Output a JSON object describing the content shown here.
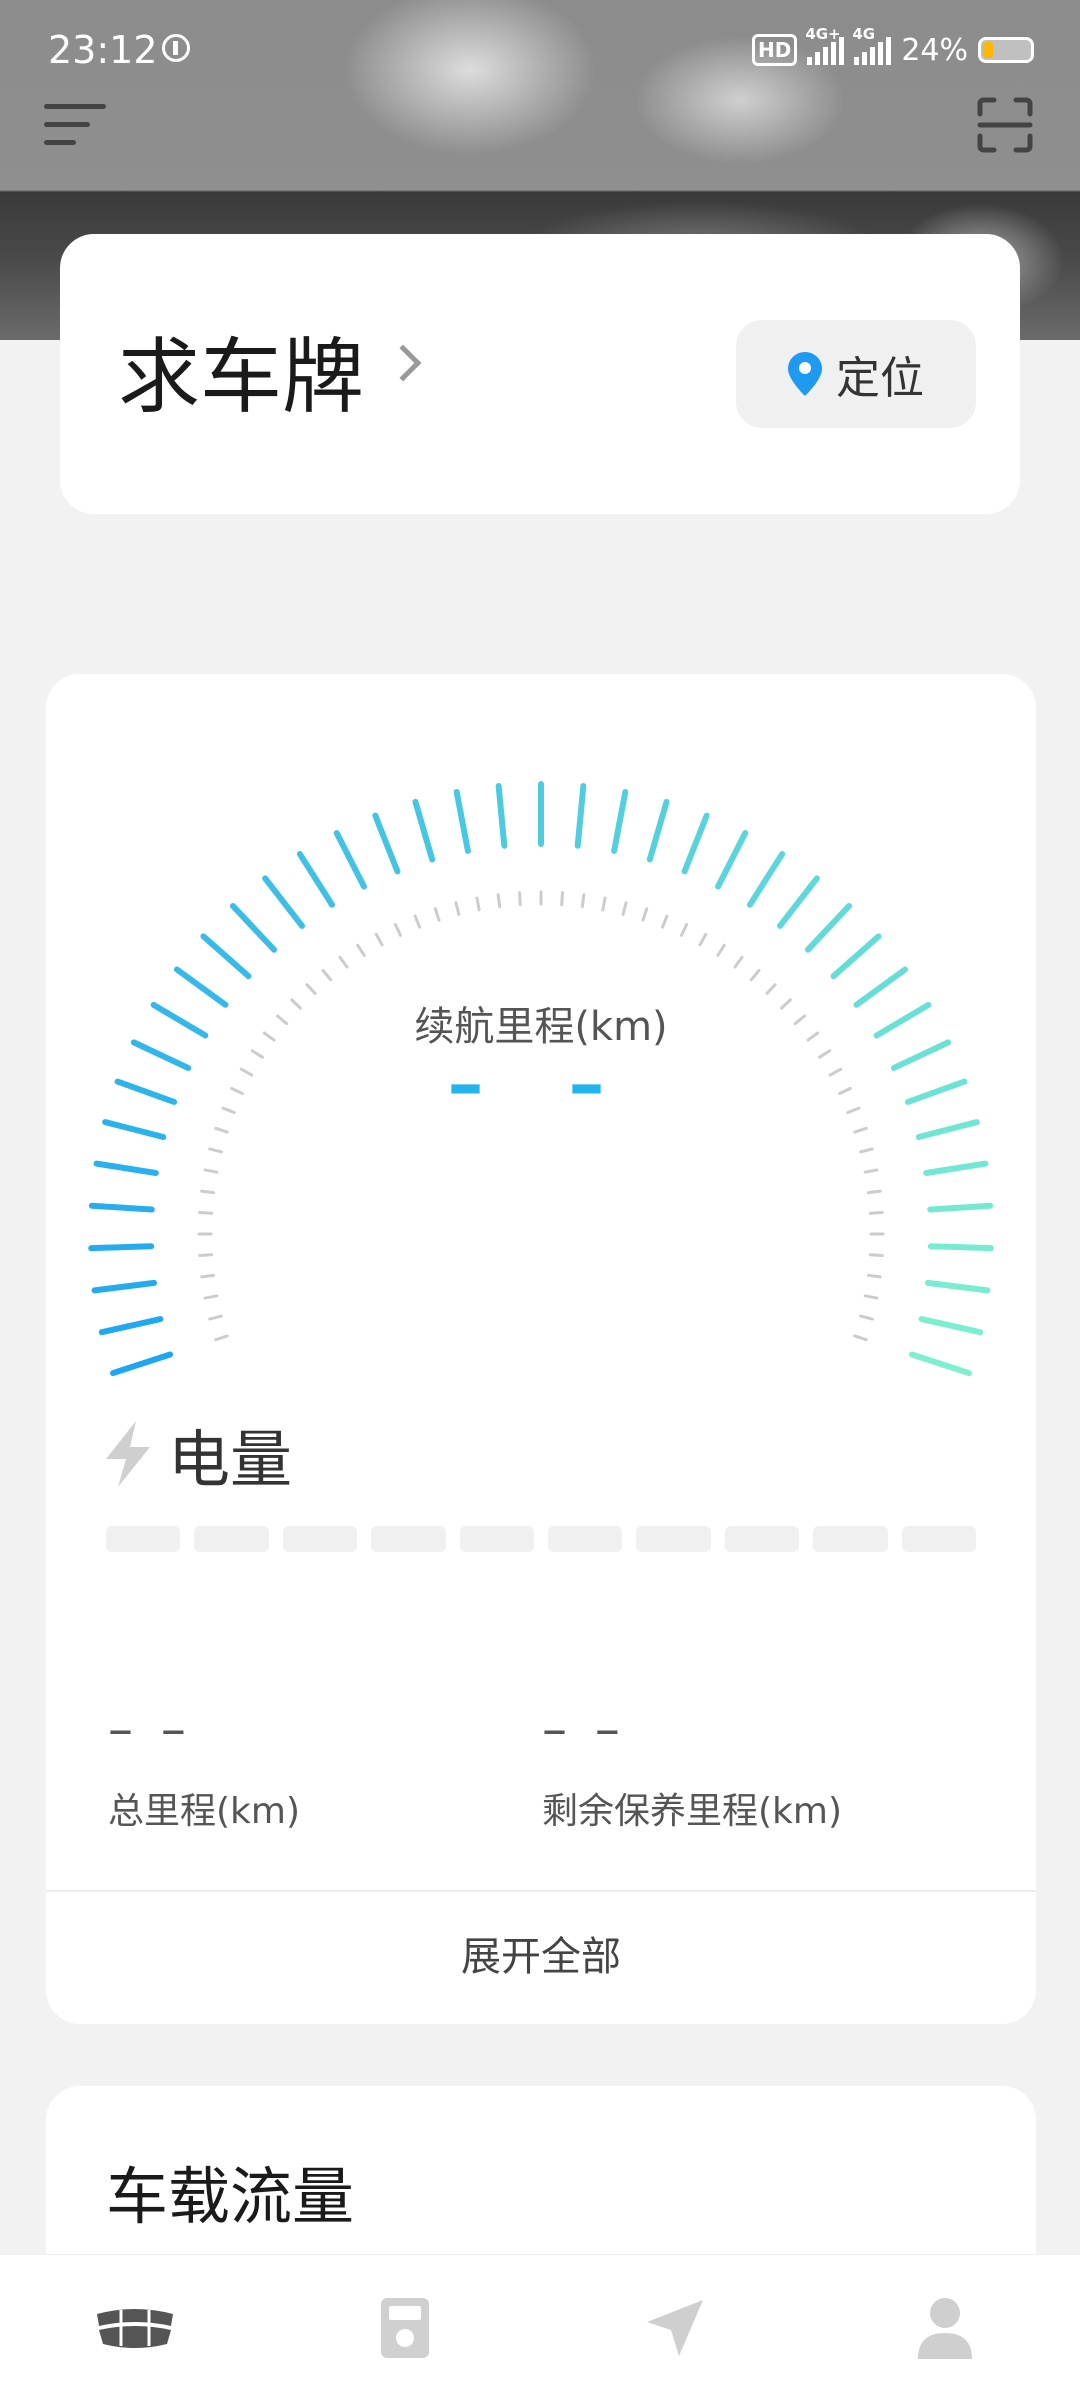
{
  "status_bar": {
    "time": "23:12",
    "hd_badge": "HD",
    "network_1": "4G+",
    "network_2": "4G",
    "battery_percent": "24%",
    "battery_level": 0.24
  },
  "header": {
    "menu_icon": "menu-icon",
    "scan_icon": "scan-icon"
  },
  "plate_card": {
    "title": "求车牌",
    "locate_label": "定位",
    "locate_icon": "location-pin-icon"
  },
  "range_card": {
    "range_label": "续航里程(km)",
    "range_value": "– –",
    "gauge_colors": {
      "start": "#1ea7f0",
      "end": "#7ef0cf",
      "inner_dots": "#cccccc"
    },
    "battery_label": "电量",
    "battery_icon": "lightning-icon",
    "battery_segments_filled": 0,
    "battery_segments_total": 10,
    "total_mileage_value": "– –",
    "total_mileage_label": "总里程(km)",
    "maintenance_value": "– –",
    "maintenance_label": "剩余保养里程(km)",
    "expand_label": "展开全部"
  },
  "traffic_card": {
    "title": "车载流量"
  },
  "bottom_nav": {
    "tabs": [
      {
        "icon": "car-brand-icon",
        "active": true
      },
      {
        "icon": "device-icon",
        "active": false
      },
      {
        "icon": "navigation-icon",
        "active": false
      },
      {
        "icon": "profile-icon",
        "active": false
      }
    ],
    "active_color": "#555555",
    "inactive_color": "#cccccc"
  }
}
